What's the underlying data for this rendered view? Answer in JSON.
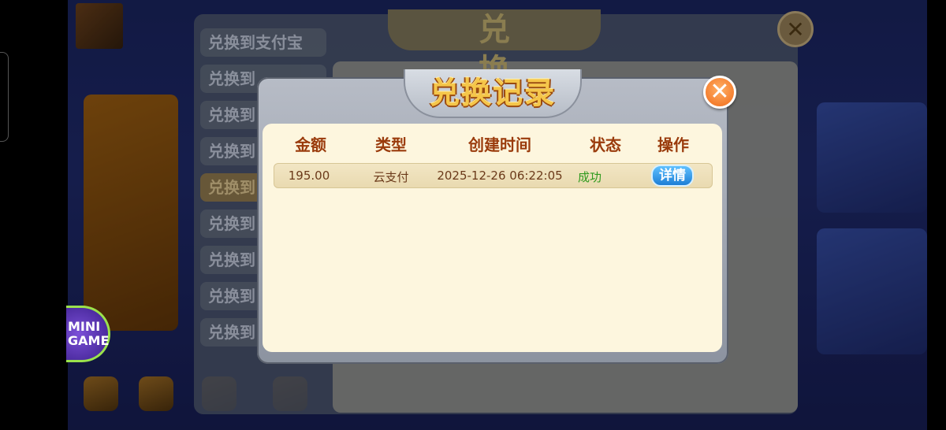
{
  "popup": {
    "title": "兑换记录",
    "close_glyph": "✕",
    "columns": [
      "金额",
      "类型",
      "创建时间",
      "状态",
      "操作"
    ],
    "rows": [
      {
        "amount": "195.00",
        "type": "云支付",
        "created": "2025-12-26 06:22:05",
        "status": "成功",
        "action_label": "详情"
      }
    ]
  },
  "background": {
    "exchange_title": "兑 换",
    "exchange_close_glyph": "✕",
    "tabs": [
      "兑换到支付宝",
      "兑换到",
      "兑换到",
      "兑换到",
      "兑换到",
      "兑换到",
      "兑换到",
      "兑换到",
      "兑换到"
    ],
    "mini_game_label": [
      "MINI",
      "GAME"
    ]
  },
  "colors": {
    "title_gold": "#f5c64a",
    "header_text": "#9a3b0c",
    "status_success": "#2f9a1e",
    "detail_button": "#1e7fd6",
    "close_button": "#f06a18"
  }
}
